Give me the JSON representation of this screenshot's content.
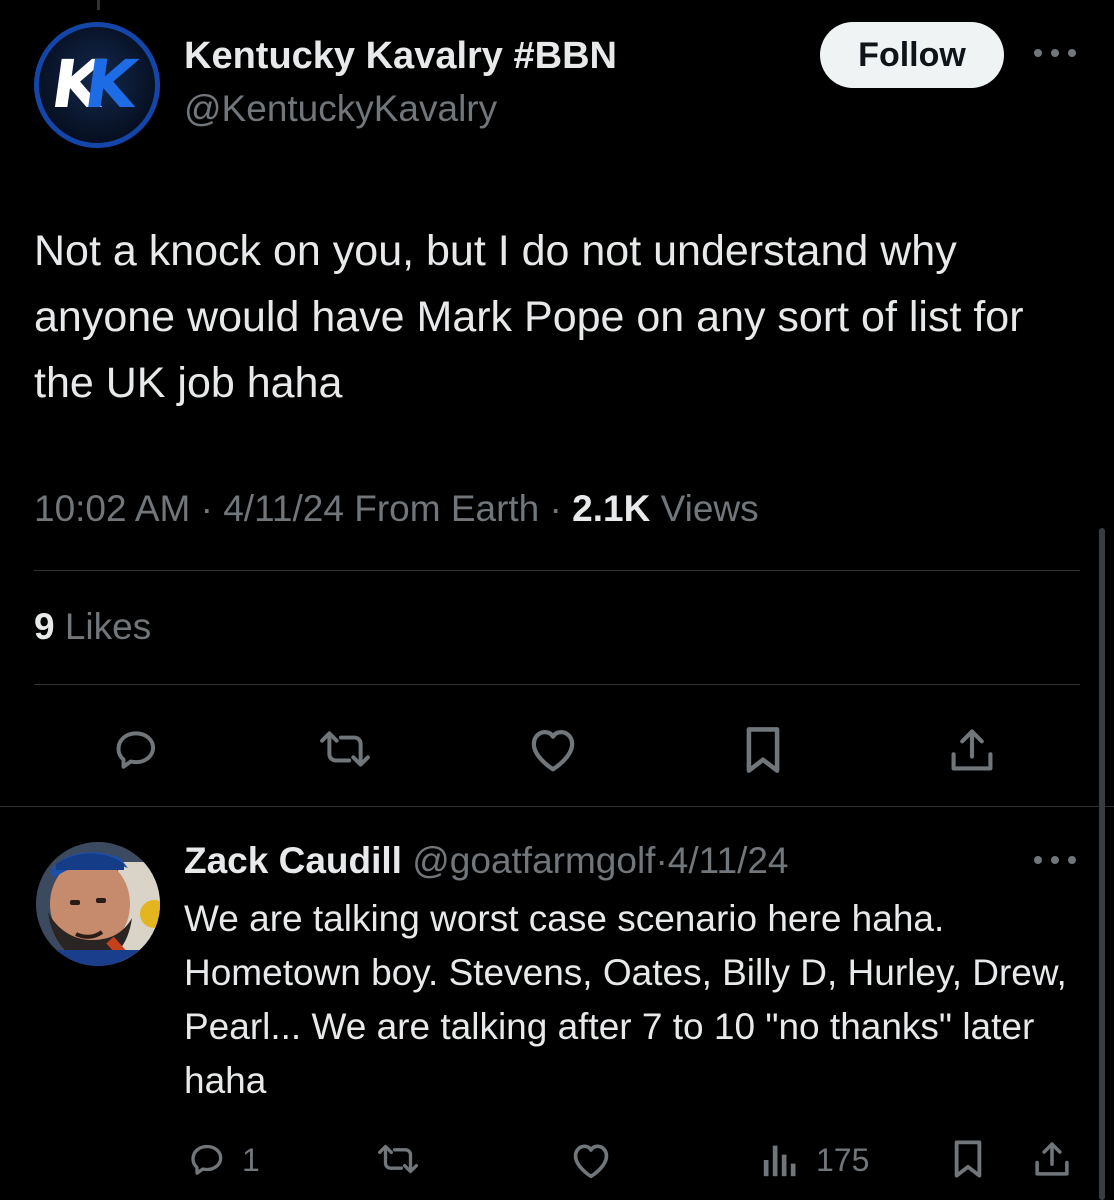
{
  "tweet": {
    "author_name": "Kentucky Kavalry #BBN",
    "author_handle": "@KentuckyKavalry",
    "avatar_letters": [
      "K",
      "K"
    ],
    "follow_label": "Follow",
    "text": "Not a knock on you, but I do not understand why anyone would have Mark Pope on any sort of list for the UK job haha",
    "time": "10:02 AM",
    "date": "4/11/24",
    "source": "From Earth",
    "views_count": "2.1K",
    "views_label": "Views",
    "likes_count": "9",
    "likes_label": "Likes",
    "actions": [
      "reply-icon",
      "retweet-icon",
      "like-icon",
      "bookmark-icon",
      "share-icon"
    ]
  },
  "reply": {
    "author_name": "Zack Caudill",
    "author_handle": "@goatfarmgolf",
    "date": "4/11/24",
    "text": "We are talking worst case scenario here haha. Hometown boy. Stevens, Oates, Billy D, Hurley, Drew, Pearl... We are talking after 7 to 10 \"no thanks\" later haha",
    "reply_count": "1",
    "views_count": "175",
    "actions": [
      "reply-icon",
      "retweet-icon",
      "like-icon",
      "views-icon",
      "bookmark-icon",
      "share-icon"
    ]
  },
  "colors": {
    "background": "#000000",
    "primary_text": "#e7e9ea",
    "secondary_text": "#71767b",
    "divider": "#2f3336",
    "follow_button_bg": "#eff3f4",
    "follow_button_text": "#0f1419",
    "avatar_ring": "#1346a8",
    "avatar_k_accent": "#1e6be6"
  }
}
